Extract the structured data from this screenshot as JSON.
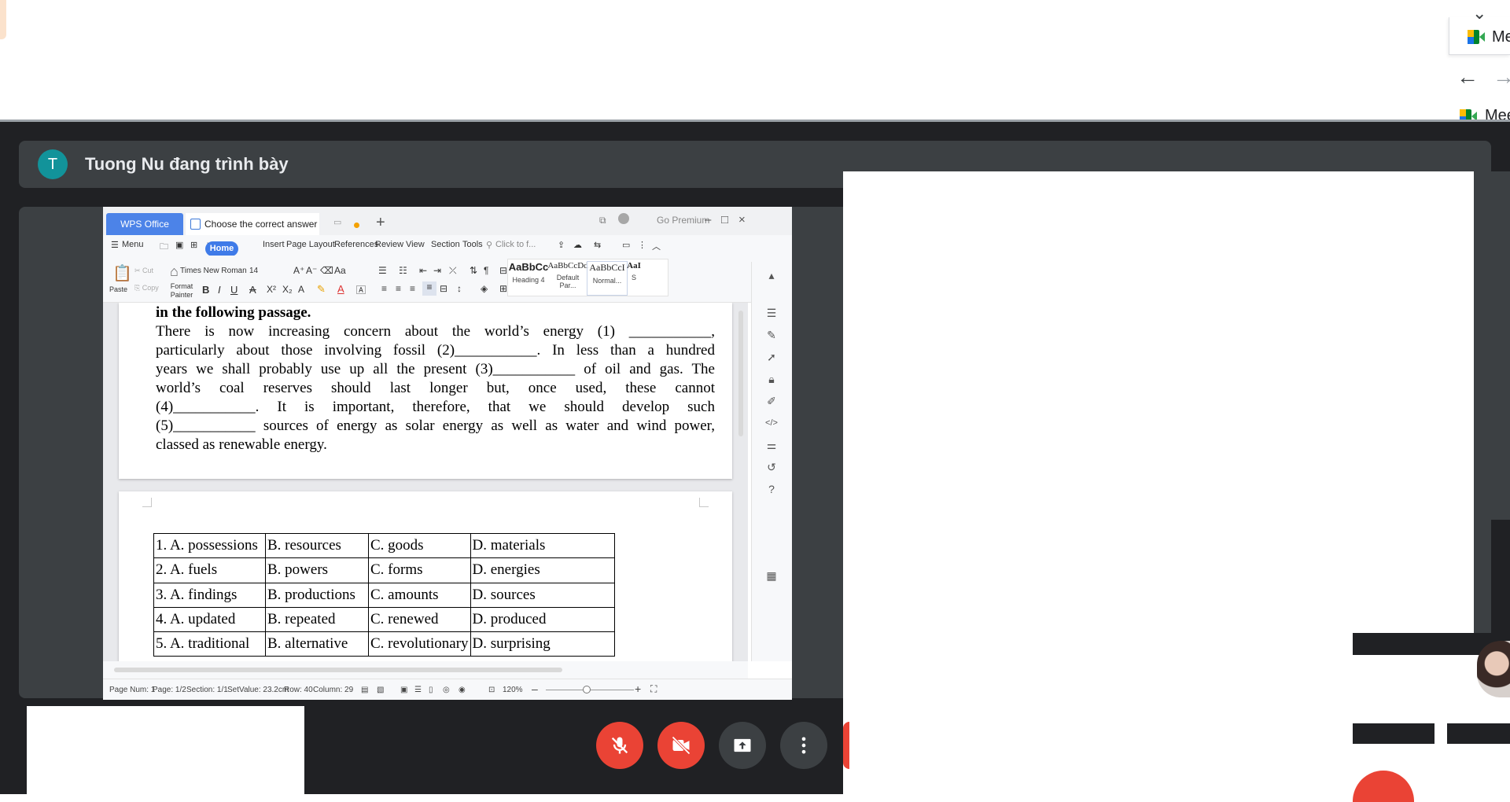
{
  "browser": {
    "tab_label": "Me",
    "tab_label_2": "Mee"
  },
  "meet": {
    "presenter_initial": "T",
    "presenter_text": "Tuong Nu đang trình bày"
  },
  "wps": {
    "logo_tab": "WPS Office",
    "doc_tab": "Choose the correct answer A",
    "go_premium": "Go Premium",
    "menu": [
      "Menu",
      "Home",
      "Insert",
      "Page Layout",
      "References",
      "Review",
      "View",
      "Section",
      "Tools"
    ],
    "search_placeholder": "Click to f...",
    "ribbon": {
      "paste": "Paste",
      "cut": "Cut",
      "copy": "Copy",
      "format_painter": "Format Painter",
      "font_name": "Times New Roman",
      "font_size": "14"
    },
    "styles": [
      {
        "preview": "AaBbCc",
        "name": "Heading 4"
      },
      {
        "preview": "AaBbCcDd",
        "name": "Default Par..."
      },
      {
        "preview": "AaBbCcI",
        "name": "Normal..."
      },
      {
        "preview": "AaI",
        "name": "S"
      }
    ],
    "document": {
      "heading": "in the following passage.",
      "passage_lines": [
        "There is now increasing concern about the world’s energy (1) ___________,",
        "particularly about those involving fossil (2)___________. In less than a hundred",
        "years we shall probably use up all the present (3)___________ of oil and gas. The",
        "world’s coal reserves should last longer but, once used, these cannot",
        "(4)___________. It is important, therefore, that we should develop such",
        "(5)___________ sources of energy as solar energy as well as water and wind power,",
        "classed as renewable energy."
      ],
      "answers": [
        [
          "1. A. possessions",
          "B. resources",
          "C. goods",
          "D. materials"
        ],
        [
          "2. A. fuels",
          "B. powers",
          "C. forms",
          "D. energies"
        ],
        [
          "3. A. findings",
          "B. productions",
          "C. amounts",
          "D. sources"
        ],
        [
          "4. A. updated",
          "B. repeated",
          "C. renewed",
          "D. produced"
        ],
        [
          "5. A. traditional",
          "B. alternative",
          "C. revolutionary",
          "D. surprising"
        ]
      ]
    },
    "status": {
      "page_num": "Page Num: 1",
      "page": "Page: 1/2",
      "section": "Section: 1/1",
      "set_value": "SetValue: 23.2cm",
      "row": "Row: 40",
      "column": "Column: 29",
      "zoom": "120%"
    }
  },
  "colors": {
    "meet_bg": "#202124",
    "meet_panel": "#3c4043",
    "control_red": "#ea4335",
    "avatar": "#12939a",
    "wps_blue": "#4c83e8"
  }
}
